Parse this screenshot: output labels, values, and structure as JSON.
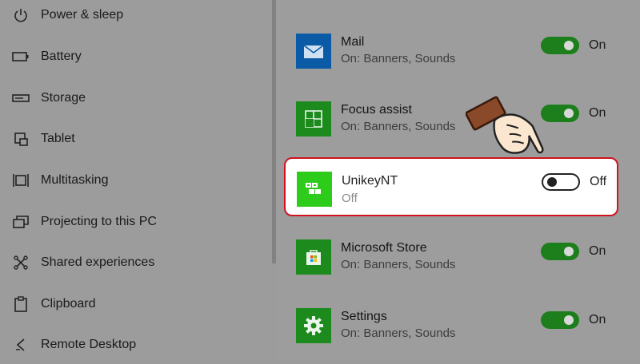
{
  "sidebar": {
    "items": [
      {
        "label": "Power & sleep",
        "icon": "power-icon"
      },
      {
        "label": "Battery",
        "icon": "battery-icon"
      },
      {
        "label": "Storage",
        "icon": "storage-icon"
      },
      {
        "label": "Tablet",
        "icon": "tablet-icon"
      },
      {
        "label": "Multitasking",
        "icon": "multitasking-icon"
      },
      {
        "label": "Projecting to this PC",
        "icon": "projecting-icon"
      },
      {
        "label": "Shared experiences",
        "icon": "shared-experiences-icon"
      },
      {
        "label": "Clipboard",
        "icon": "clipboard-icon"
      },
      {
        "label": "Remote Desktop",
        "icon": "remote-desktop-icon"
      }
    ]
  },
  "apps": [
    {
      "name": "Mail",
      "status": "On: Banners, Sounds",
      "toggle": "On",
      "icon": "mail-icon",
      "color": "#0a5aa6"
    },
    {
      "name": "Focus assist",
      "status": "On: Banners, Sounds",
      "toggle": "On",
      "icon": "focus-assist-icon",
      "color": "#1c8a1c"
    },
    {
      "name": "UnikeyNT",
      "status": "Off",
      "toggle": "Off",
      "icon": "unikey-icon",
      "color": "#2ecc1a"
    },
    {
      "name": "Microsoft Store",
      "status": "On: Banners, Sounds",
      "toggle": "On",
      "icon": "store-icon",
      "color": "#1c8a1c"
    },
    {
      "name": "Settings",
      "status": "On: Banners, Sounds",
      "toggle": "On",
      "icon": "settings-gear-icon",
      "color": "#1c8a1c"
    }
  ],
  "colors": {
    "toggle_on": "#1c7f1c",
    "highlight_border": "#d0141f"
  }
}
